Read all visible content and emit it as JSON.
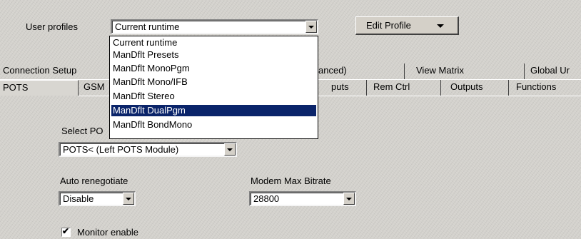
{
  "profiles": {
    "label": "User profiles",
    "selected": "Current runtime",
    "options": [
      "Current runtime",
      "ManDflt Presets",
      "ManDflt MonoPgm",
      "ManDflt Mono/IFB",
      "ManDflt Stereo",
      "ManDflt DualPgm",
      "ManDflt BondMono"
    ],
    "highlighted_index": 5
  },
  "edit_profile": {
    "label": "Edit Profile"
  },
  "tabs_row1": [
    "Connection Setup",
    "anced)",
    "View Matrix",
    "Global Ur"
  ],
  "tabs_row2": [
    "POTS",
    "GSM",
    "puts",
    "Rem Ctrl",
    "Outputs",
    "Functions"
  ],
  "form": {
    "select_pots_label": "Select PO",
    "select_pots_value": "POTS< (Left POTS Module)",
    "auto_reneg_label": "Auto renegotiate",
    "auto_reneg_value": "Disable",
    "modem_label": "Modem Max Bitrate",
    "modem_value": "28800",
    "monitor_label": "Monitor enable",
    "monitor_checked": true
  }
}
